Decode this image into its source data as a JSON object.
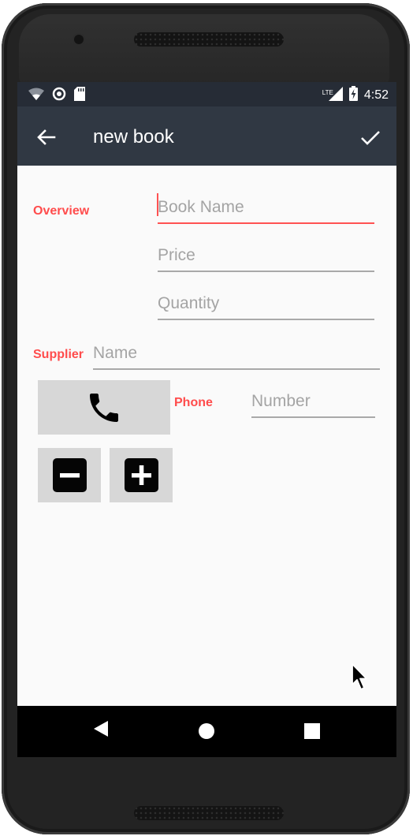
{
  "status_bar": {
    "time": "4:52",
    "network_label": "LTE",
    "icons": [
      "wifi-icon",
      "circle-sync-icon",
      "sd-card-icon",
      "signal-icon",
      "battery-charging-icon"
    ]
  },
  "app_bar": {
    "title": "new book",
    "back_icon": "arrow-back-icon",
    "save_icon": "check-icon"
  },
  "form": {
    "overview_label": "Overview",
    "book_name": {
      "value": "",
      "placeholder": "Book Name"
    },
    "price": {
      "value": "",
      "placeholder": "Price"
    },
    "quantity": {
      "value": "",
      "placeholder": "Quantity"
    },
    "supplier_label": "Supplier",
    "supplier_name": {
      "value": "",
      "placeholder": "Name"
    },
    "phone_label": "Phone",
    "phone_number": {
      "value": "",
      "placeholder": "Number"
    },
    "call_icon": "phone-icon",
    "decrease_icon": "minus-box-icon",
    "increase_icon": "plus-box-icon"
  },
  "nav_bar": {
    "icons": [
      "back-triangle-icon",
      "home-circle-icon",
      "recents-square-icon"
    ]
  },
  "colors": {
    "status_bar": "#262c36",
    "app_bar": "#303843",
    "accent_red": "#ff4c4c",
    "button_gray": "#d7d7d7",
    "screen_bg": "#fafafa"
  }
}
